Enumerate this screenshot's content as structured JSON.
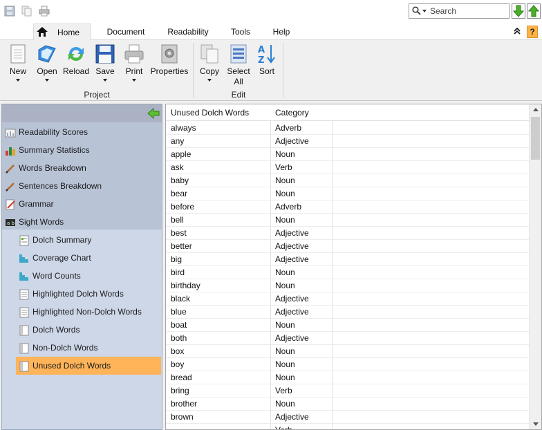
{
  "title_bar": {
    "search": {
      "placeholder": "Search",
      "value": ""
    }
  },
  "tabs": [
    {
      "label": "Home",
      "active": true
    },
    {
      "label": "Document",
      "active": false
    },
    {
      "label": "Readability",
      "active": false
    },
    {
      "label": "Tools",
      "active": false
    },
    {
      "label": "Help",
      "active": false
    }
  ],
  "help_button": {
    "label": "?"
  },
  "ribbon": {
    "buttons": [
      {
        "label": "New",
        "icon": "new-document-icon",
        "dropdown": true
      },
      {
        "label": "Open",
        "icon": "open-folder-icon",
        "dropdown": true
      },
      {
        "label": "Reload",
        "icon": "reload-icon",
        "dropdown": false
      },
      {
        "label": "Save",
        "icon": "save-disk-icon",
        "dropdown": true
      },
      {
        "label": "Print",
        "icon": "printer-icon",
        "dropdown": true
      },
      {
        "label": "Properties",
        "icon": "properties-icon",
        "dropdown": false
      },
      {
        "label": "Copy",
        "icon": "copy-icon",
        "dropdown": true
      },
      {
        "label": "Select All",
        "label_line1": "Select",
        "label_line2": "All",
        "icon": "select-all-icon",
        "dropdown": false
      },
      {
        "label": "Sort",
        "icon": "sort-az-icon",
        "dropdown": false
      }
    ],
    "groups": [
      {
        "label": "Project"
      },
      {
        "label": "Edit"
      }
    ]
  },
  "sidebar": {
    "items": [
      {
        "label": "Readability Scores",
        "icon": "bar-chart-icon"
      },
      {
        "label": "Summary Statistics",
        "icon": "stats-icon"
      },
      {
        "label": "Words Breakdown",
        "icon": "pencil-icon"
      },
      {
        "label": "Sentences Breakdown",
        "icon": "pencil-icon"
      },
      {
        "label": "Grammar",
        "icon": "grammar-check-icon"
      },
      {
        "label": "Sight Words",
        "icon": "sight-words-icon"
      }
    ],
    "children": [
      {
        "label": "Dolch Summary",
        "icon": "summary-report-icon",
        "selected": false
      },
      {
        "label": "Coverage Chart",
        "icon": "coverage-chart-icon",
        "selected": false
      },
      {
        "label": "Word Counts",
        "icon": "word-counts-chart-icon",
        "selected": false
      },
      {
        "label": "Highlighted Dolch Words",
        "icon": "document-icon",
        "selected": false
      },
      {
        "label": "Highlighted Non-Dolch Words",
        "icon": "document-icon",
        "selected": false
      },
      {
        "label": "Dolch Words",
        "icon": "list-icon",
        "selected": false
      },
      {
        "label": "Non-Dolch Words",
        "icon": "list-icon",
        "selected": false
      },
      {
        "label": "Unused Dolch Words",
        "icon": "list-icon",
        "selected": true
      }
    ]
  },
  "table": {
    "columns": [
      "Unused Dolch Words",
      "Category"
    ],
    "rows": [
      [
        "always",
        "Adverb"
      ],
      [
        "any",
        "Adjective"
      ],
      [
        "apple",
        "Noun"
      ],
      [
        "ask",
        "Verb"
      ],
      [
        "baby",
        "Noun"
      ],
      [
        "bear",
        "Noun"
      ],
      [
        "before",
        "Adverb"
      ],
      [
        "bell",
        "Noun"
      ],
      [
        "best",
        "Adjective"
      ],
      [
        "better",
        "Adjective"
      ],
      [
        "big",
        "Adjective"
      ],
      [
        "bird",
        "Noun"
      ],
      [
        "birthday",
        "Noun"
      ],
      [
        "black",
        "Adjective"
      ],
      [
        "blue",
        "Adjective"
      ],
      [
        "boat",
        "Noun"
      ],
      [
        "both",
        "Adjective"
      ],
      [
        "box",
        "Noun"
      ],
      [
        "boy",
        "Noun"
      ],
      [
        "bread",
        "Noun"
      ],
      [
        "bring",
        "Verb"
      ],
      [
        "brother",
        "Noun"
      ],
      [
        "brown",
        "Adjective"
      ],
      [
        "",
        "Verb"
      ]
    ]
  },
  "colors": {
    "sidebar_bg": "#b8c3d6",
    "sidebar_child_bg": "#cdd7e8",
    "selected": "#ffb45a",
    "accent_green": "#4caf2a",
    "help_orange": "#ffb347"
  }
}
